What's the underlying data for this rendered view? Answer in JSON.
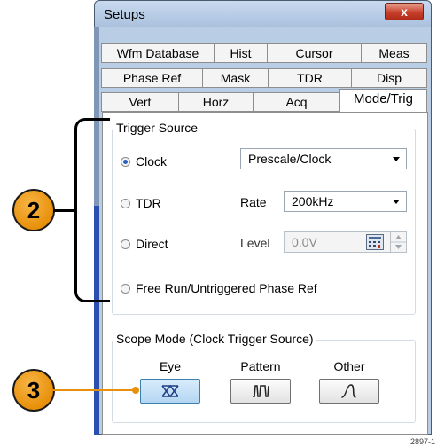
{
  "window": {
    "title": "Setups",
    "close_label": "x"
  },
  "tabs": {
    "row1": [
      "Wfm Database",
      "Hist",
      "Cursor",
      "Meas"
    ],
    "row2": [
      "Phase Ref",
      "Mask",
      "TDR",
      "Disp"
    ],
    "row3": [
      "Vert",
      "Horz",
      "Acq",
      "Mode/Trig"
    ],
    "active": "Mode/Trig"
  },
  "trigger_source": {
    "title": "Trigger Source",
    "options": [
      {
        "label": "Clock",
        "checked": true
      },
      {
        "label": "TDR",
        "checked": false
      },
      {
        "label": "Direct",
        "checked": false
      },
      {
        "label": "Free Run/Untriggered Phase Ref",
        "checked": false
      }
    ],
    "clock_select": "Prescale/Clock",
    "rate_label": "Rate",
    "rate_value": "200kHz",
    "level_label": "Level",
    "level_value": "0.0V"
  },
  "scope_mode": {
    "title": "Scope Mode (Clock Trigger Source)",
    "modes": [
      {
        "label": "Eye",
        "icon": "eye-diagram-icon",
        "selected": true
      },
      {
        "label": "Pattern",
        "icon": "pattern-icon",
        "selected": false
      },
      {
        "label": "Other",
        "icon": "waveform-icon",
        "selected": false
      }
    ]
  },
  "callouts": [
    "2",
    "3"
  ],
  "figure_id": "2897-1"
}
